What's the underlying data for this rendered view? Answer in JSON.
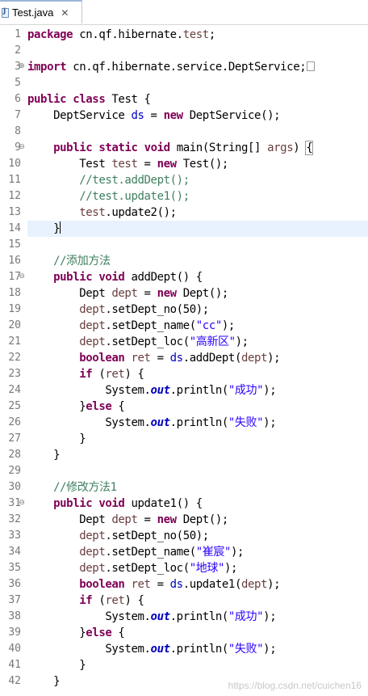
{
  "tab": {
    "title": "Test.java",
    "close": "✕"
  },
  "watermark": "https://blog.csdn.net/cuichen16",
  "lines": [
    {
      "n": "1",
      "c": "package cn.qf.hibernate.test;"
    },
    {
      "n": "2",
      "c": ""
    },
    {
      "n": "3",
      "c": "import cn.qf.hibernate.service.DeptService;",
      "fold": "plus"
    },
    {
      "n": "5",
      "c": ""
    },
    {
      "n": "6",
      "c": "public class Test {"
    },
    {
      "n": "7",
      "c": "    DeptService ds = new DeptService();"
    },
    {
      "n": "8",
      "c": ""
    },
    {
      "n": "9",
      "c": "    public static void main(String[] args) {",
      "fold": "minus"
    },
    {
      "n": "10",
      "c": "        Test test = new Test();"
    },
    {
      "n": "11",
      "c": "        //test.addDept();"
    },
    {
      "n": "12",
      "c": "        //test.update1();"
    },
    {
      "n": "13",
      "c": "        test.update2();"
    },
    {
      "n": "14",
      "c": "    }",
      "current": true
    },
    {
      "n": "15",
      "c": ""
    },
    {
      "n": "16",
      "c": "    //添加方法"
    },
    {
      "n": "17",
      "c": "    public void addDept() {",
      "fold": "minus"
    },
    {
      "n": "18",
      "c": "        Dept dept = new Dept();"
    },
    {
      "n": "19",
      "c": "        dept.setDept_no(50);"
    },
    {
      "n": "20",
      "c": "        dept.setDept_name(\"cc\");"
    },
    {
      "n": "21",
      "c": "        dept.setDept_loc(\"高新区\");"
    },
    {
      "n": "22",
      "c": "        boolean ret = ds.addDept(dept);"
    },
    {
      "n": "23",
      "c": "        if (ret) {"
    },
    {
      "n": "24",
      "c": "            System.out.println(\"成功\");"
    },
    {
      "n": "25",
      "c": "        }else {"
    },
    {
      "n": "26",
      "c": "            System.out.println(\"失败\");"
    },
    {
      "n": "27",
      "c": "        }"
    },
    {
      "n": "28",
      "c": "    }"
    },
    {
      "n": "29",
      "c": ""
    },
    {
      "n": "30",
      "c": "    //修改方法1"
    },
    {
      "n": "31",
      "c": "    public void update1() {",
      "fold": "minus"
    },
    {
      "n": "32",
      "c": "        Dept dept = new Dept();"
    },
    {
      "n": "33",
      "c": "        dept.setDept_no(50);"
    },
    {
      "n": "34",
      "c": "        dept.setDept_name(\"崔宸\");"
    },
    {
      "n": "35",
      "c": "        dept.setDept_loc(\"地球\");"
    },
    {
      "n": "36",
      "c": "        boolean ret = ds.update1(dept);"
    },
    {
      "n": "37",
      "c": "        if (ret) {"
    },
    {
      "n": "38",
      "c": "            System.out.println(\"成功\");"
    },
    {
      "n": "39",
      "c": "        }else {"
    },
    {
      "n": "40",
      "c": "            System.out.println(\"失败\");"
    },
    {
      "n": "41",
      "c": "        }"
    },
    {
      "n": "42",
      "c": "    }"
    }
  ]
}
